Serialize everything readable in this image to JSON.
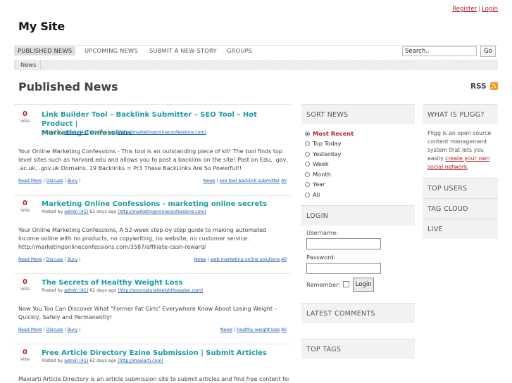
{
  "header": {
    "register": "Register",
    "separator": "|",
    "login": "Login",
    "site_name": "My Site"
  },
  "nav": {
    "items": [
      "PUBLISHED NEWS",
      "UPCOMING NEWS",
      "SUBMIT A NEW STORY",
      "GROUPS"
    ],
    "search_value": "Search..",
    "search_button": "Go"
  },
  "subnav": {
    "tab": "News"
  },
  "page": {
    "title": "Published News",
    "rss": "RSS"
  },
  "stories": [
    {
      "votes": "0",
      "vote_label": "Vote",
      "title_line1": "Link Builder Tool – Backlink Submitter – SEO Tool – Hot Product |",
      "title_line2": "Marketing Confessions",
      "posted_by": "Posted by",
      "author": "admin (41)",
      "age": "62 days ago",
      "url": "(http://marketingonlineconfessions.com)",
      "body": "Your Online Marketing Confessions - This tool is an outstanding piece of kit! The tool finds top level sites such as harvard.edu and allows you to post a backlink on the site! Post on Edu, .gov, .ac.uk, .gov.uk Domains. 19 Backlinks = Pr3 These BackLinks Are So Powerful!!",
      "read_more": "Read More",
      "discuss": "Discuss",
      "bury": "Bury",
      "tags": [
        "News",
        "seo tool backlink submitter",
        "All"
      ]
    },
    {
      "votes": "0",
      "vote_label": "Vote",
      "title_line1": "Marketing Online Confessions - marketing online secrets",
      "title_line2": "",
      "posted_by": "Posted by",
      "author": "admin (41)",
      "age": "62 days ago",
      "url": "(http://marketingonlineconfessions.com)",
      "body": "Your Online Marketing Confessions, A 52-week step-by-step guide to making automated income online with no products, no copywriting, no website, no customer service. http://marketingonlineconfessions.com/3587/affiliate-cash-reward/",
      "read_more": "Read More",
      "discuss": "Discuss",
      "bury": "Bury",
      "tags": [
        "News",
        "web marketing online solutions",
        "All"
      ]
    },
    {
      "votes": "0",
      "vote_label": "Vote",
      "title_line1": "The Secrets of Healthy Weight Loss",
      "title_line2": "",
      "posted_by": "Posted by",
      "author": "admin (41)",
      "age": "62 days ago",
      "url": "(http://yournaturalweightlossplan.com)",
      "body": "Now You Too Can Discover What \"Former Fat Girls\" Everywhere Know About Losing Weight – Quickly, Safely and Permanently!",
      "read_more": "Read More",
      "discuss": "Discuss",
      "bury": "Bury",
      "tags": [
        "News",
        "healthy weight loss",
        "All"
      ]
    },
    {
      "votes": "0",
      "vote_label": "Vote",
      "title_line1": "Free Article Directory Ezine Submission | Submit Articles",
      "title_line2": "",
      "posted_by": "Posted by",
      "author": "admin (41)",
      "age": "62 days ago",
      "url": "(http://maxiarti.com)",
      "body": "Maxiarti Article Directory is an article submission site to submit articles and find free content for"
    }
  ],
  "sidebar": {
    "sort_title": "SORT NEWS",
    "sort_options": [
      "Most Recent",
      "Top Today",
      "Yesterday",
      "Week",
      "Month",
      "Year",
      "All"
    ],
    "login_title": "LOGIN",
    "username_label": "Username:",
    "password_label": "Password:",
    "remember_label": "Remember:",
    "login_button": "Login",
    "latest_comments": "LATEST COMMENTS",
    "top_tags": "TOP TAGS",
    "what_is_title": "WHAT IS PLIGG?",
    "what_is_text": "Pligg is an open source content management system that lets you easily",
    "what_is_link": "create your own social network",
    "what_is_end": ".",
    "top_users": "TOP USERS",
    "tag_cloud": "TAG CLOUD",
    "live": "LIVE"
  },
  "colors": {
    "accent_red": "#b8232b",
    "title_teal": "#1d9aa3",
    "link_blue": "#1a5aa6",
    "rss_orange": "#f29b22"
  }
}
